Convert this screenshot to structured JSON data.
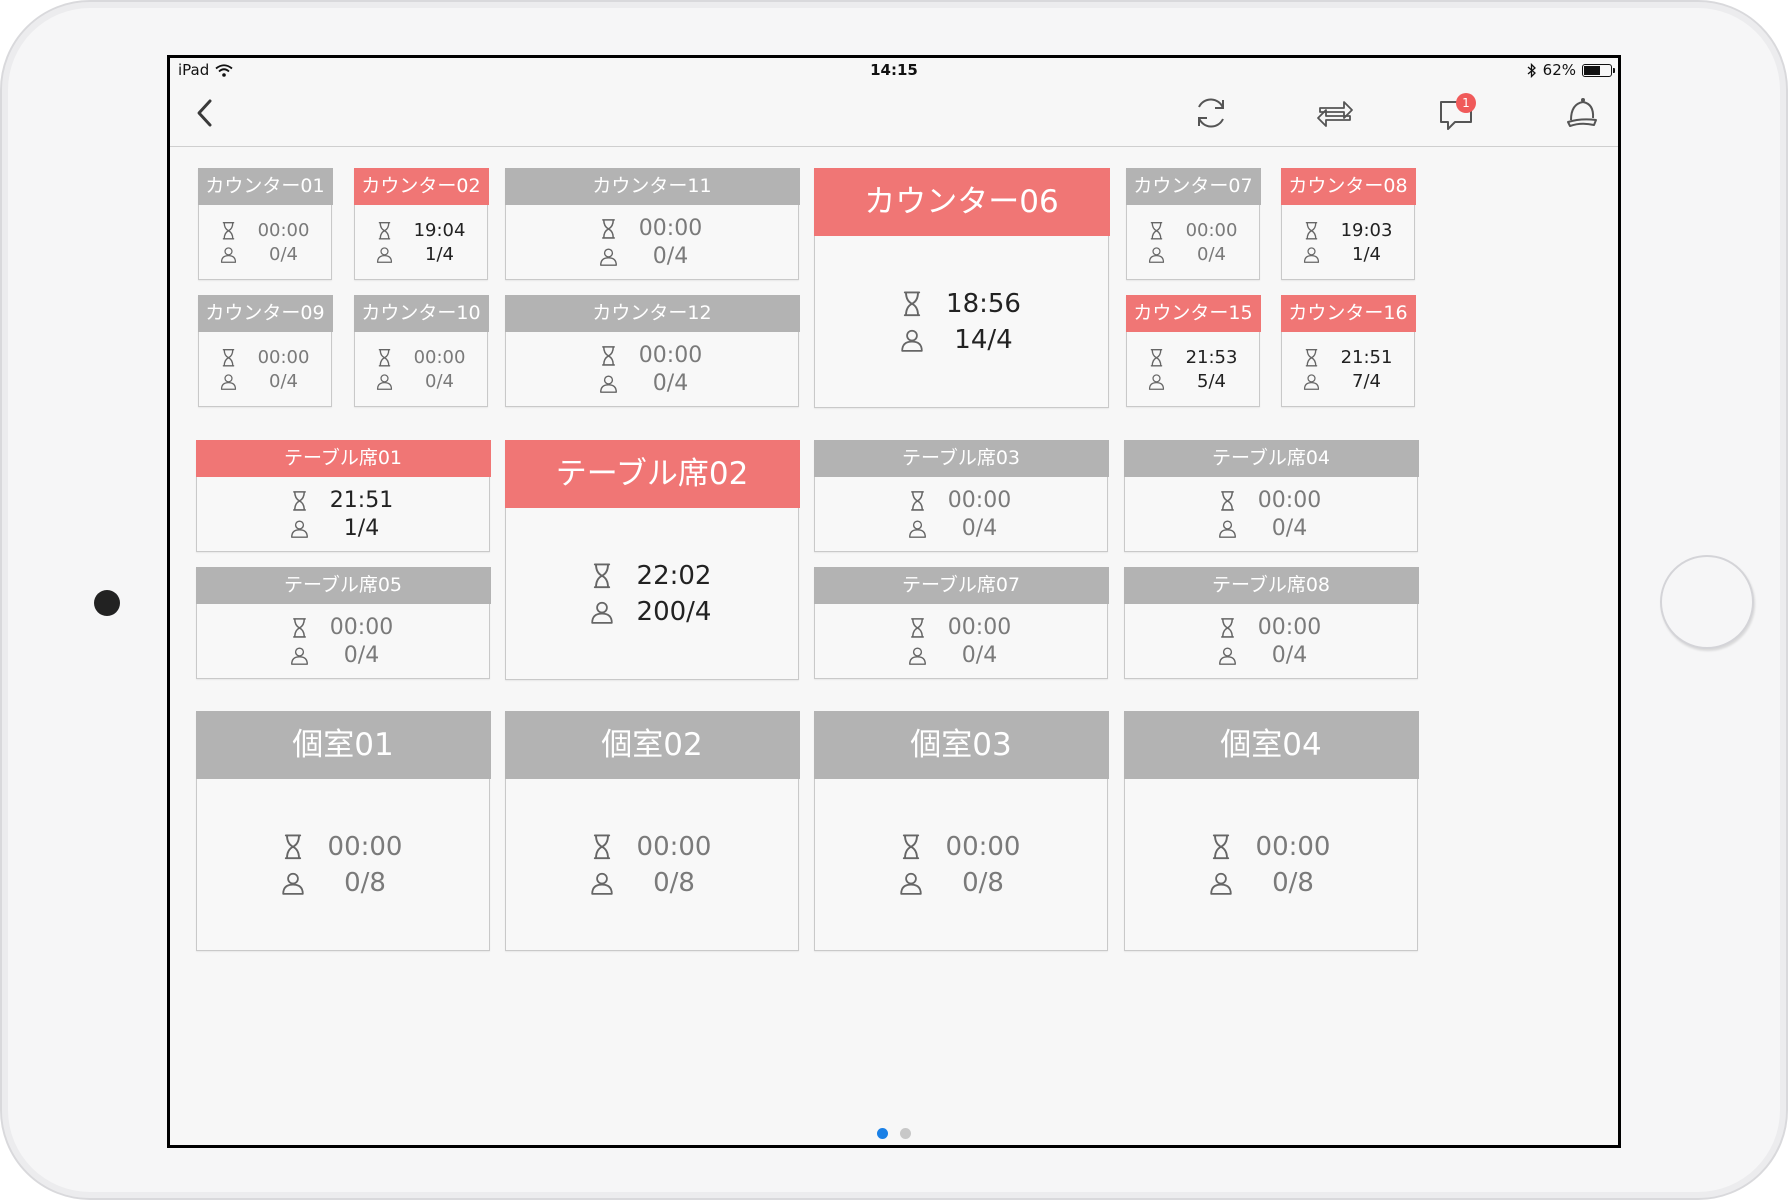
{
  "status_bar": {
    "device": "iPad",
    "time": "14:15",
    "battery": "62%",
    "battery_level": 0.62
  },
  "nav": {
    "notification_count": "1"
  },
  "colors": {
    "active": "#f07675",
    "inactive": "#b3b3b3",
    "page_dot_active": "#1a80e6"
  },
  "tiles": [
    {
      "name": "カウンター01",
      "time": "00:00",
      "guests": "0/4",
      "active": false
    },
    {
      "name": "カウンター02",
      "time": "19:04",
      "guests": "1/4",
      "active": true
    },
    {
      "name": "カウンター11",
      "time": "00:00",
      "guests": "0/4",
      "active": false
    },
    {
      "name": "カウンター06",
      "time": "18:56",
      "guests": "14/4",
      "active": true
    },
    {
      "name": "カウンター07",
      "time": "00:00",
      "guests": "0/4",
      "active": false
    },
    {
      "name": "カウンター08",
      "time": "19:03",
      "guests": "1/4",
      "active": true
    },
    {
      "name": "カウンター09",
      "time": "00:00",
      "guests": "0/4",
      "active": false
    },
    {
      "name": "カウンター10",
      "time": "00:00",
      "guests": "0/4",
      "active": false
    },
    {
      "name": "カウンター12",
      "time": "00:00",
      "guests": "0/4",
      "active": false
    },
    {
      "name": "カウンター15",
      "time": "21:53",
      "guests": "5/4",
      "active": true
    },
    {
      "name": "カウンター16",
      "time": "21:51",
      "guests": "7/4",
      "active": true
    },
    {
      "name": "テーブル席01",
      "time": "21:51",
      "guests": "1/4",
      "active": true
    },
    {
      "name": "テーブル席02",
      "time": "22:02",
      "guests": "200/4",
      "active": true
    },
    {
      "name": "テーブル席03",
      "time": "00:00",
      "guests": "0/4",
      "active": false
    },
    {
      "name": "テーブル席04",
      "time": "00:00",
      "guests": "0/4",
      "active": false
    },
    {
      "name": "テーブル席05",
      "time": "00:00",
      "guests": "0/4",
      "active": false
    },
    {
      "name": "テーブル席07",
      "time": "00:00",
      "guests": "0/4",
      "active": false
    },
    {
      "name": "テーブル席08",
      "time": "00:00",
      "guests": "0/4",
      "active": false
    },
    {
      "name": "個室01",
      "time": "00:00",
      "guests": "0/8",
      "active": false
    },
    {
      "name": "個室02",
      "time": "00:00",
      "guests": "0/8",
      "active": false
    },
    {
      "name": "個室03",
      "time": "00:00",
      "guests": "0/8",
      "active": false
    },
    {
      "name": "個室04",
      "time": "00:00",
      "guests": "0/8",
      "active": false
    }
  ],
  "pager": {
    "page_count": 2,
    "current_page": 1
  }
}
